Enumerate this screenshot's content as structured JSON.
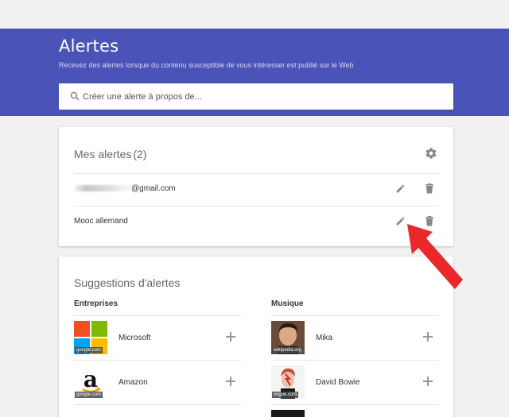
{
  "header": {
    "title": "Alertes",
    "subtitle": "Recevez des alertes lorsque du contenu susceptible de vous intéresser est publié sur le Web",
    "search_placeholder": "Créer une alerte à propos de..."
  },
  "my_alerts": {
    "title": "Mes alertes",
    "count": "(2)",
    "items": [
      {
        "label": "@gmail.com",
        "masked": true
      },
      {
        "label": "Mooc allemand",
        "masked": false
      }
    ]
  },
  "suggestions": {
    "title": "Suggestions d'alertes",
    "columns": [
      {
        "heading": "Entreprises",
        "items": [
          {
            "name": "Microsoft",
            "source": "google.com",
            "thumb": "microsoft-logo"
          },
          {
            "name": "Amazon",
            "source": "google.com",
            "thumb": "amazon-logo"
          }
        ]
      },
      {
        "heading": "Musique",
        "items": [
          {
            "name": "Mika",
            "source": "wikipedia.org",
            "thumb": "mika-photo"
          },
          {
            "name": "David Bowie",
            "source": "vogue.com",
            "thumb": "david-bowie-photo"
          }
        ]
      }
    ]
  },
  "colors": {
    "header_bg": "#4a53b8",
    "page_bg": "#f1f1f1",
    "annotation_arrow": "#e8282a"
  }
}
